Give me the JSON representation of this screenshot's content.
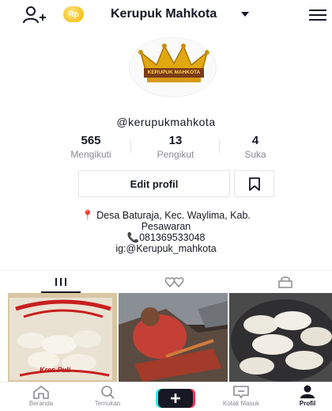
{
  "header": {
    "add_user_icon": "person-add-icon",
    "coin_label": "Rp",
    "account_name": "Kerupuk Mahkota",
    "menu_icon": "hamburger-menu-icon"
  },
  "profile": {
    "avatar_text": "KERUPUK MAHKOTA",
    "username": "@kerupukmahkota",
    "stats": [
      {
        "value": "565",
        "label": "Mengikuti"
      },
      {
        "value": "13",
        "label": "Pengikut"
      },
      {
        "value": "4",
        "label": "Suka"
      }
    ],
    "edit_button": "Edit profil",
    "bio": {
      "location_line1": "Desa Baturaja, Kec. Waylima, Kab.",
      "location_line2": "Pesawaran",
      "phone": "081369533048",
      "instagram": "ig:@Kerupuk_mahkota"
    }
  },
  "tabs": [
    {
      "icon": "grid-icon",
      "active": true
    },
    {
      "icon": "liked-hearts-icon",
      "active": false
    },
    {
      "icon": "lock-icon",
      "active": false
    }
  ],
  "videos": [
    {
      "thumb_text": "Kres Puli"
    },
    {
      "thumb_text": ""
    },
    {
      "thumb_text": ""
    }
  ],
  "nav": [
    {
      "label": "Beranda",
      "icon": "home-icon",
      "active": false
    },
    {
      "label": "Temukan",
      "icon": "search-icon",
      "active": false
    },
    {
      "label": "",
      "icon": "plus-icon",
      "active": false
    },
    {
      "label": "Kotak Masuk",
      "icon": "inbox-icon",
      "active": false
    },
    {
      "label": "Profil",
      "icon": "profile-icon",
      "active": true
    }
  ],
  "colors": {
    "text": "#161823",
    "muted": "#8a8b91",
    "plus_left": "#25f4ee",
    "plus_right": "#fe2c55",
    "coin": "#f2b600"
  }
}
